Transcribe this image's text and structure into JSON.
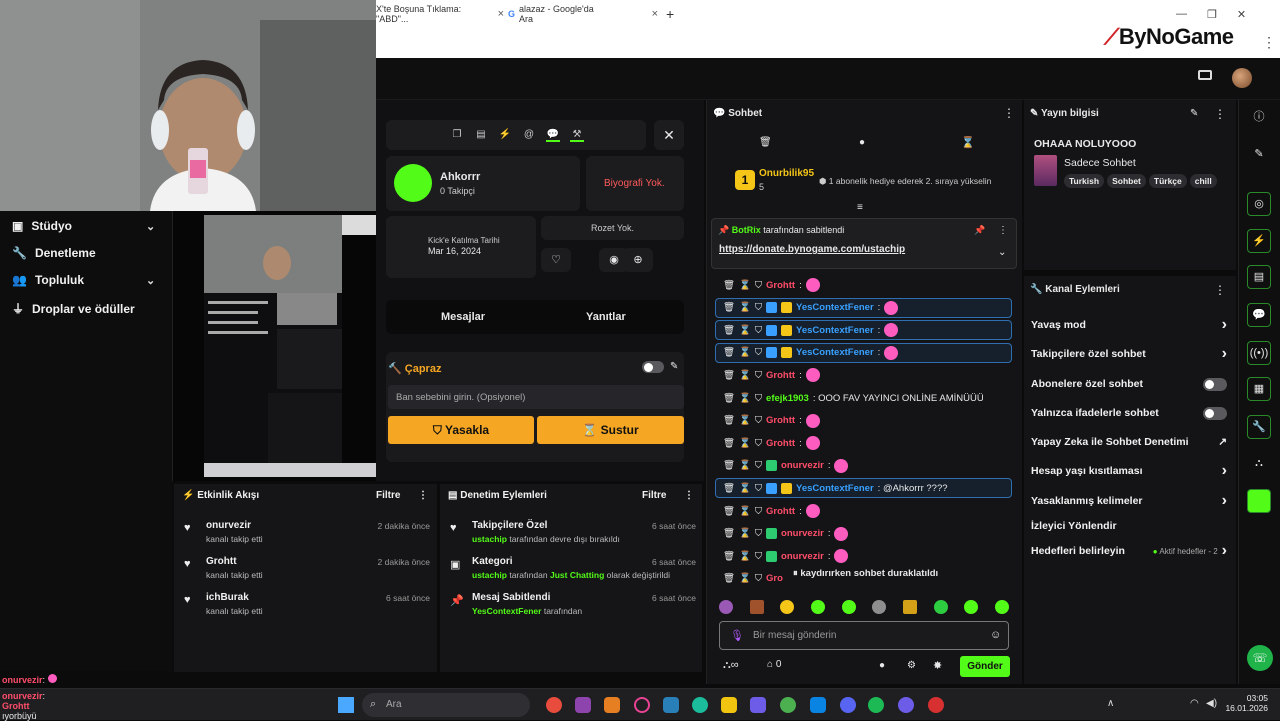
{
  "browser": {
    "tabs": [
      {
        "label": "X'te Boşuna Tıklama: \"ABD\"..."
      },
      {
        "label": "alazaz - Google'da Ara"
      }
    ],
    "new_tab": "+",
    "overlay_logo": "ByNoGame",
    "menu": "⋮"
  },
  "left_nav": {
    "items": [
      {
        "label": "Stüdyo"
      },
      {
        "label": "Denetleme"
      },
      {
        "label": "Topluluk"
      },
      {
        "label": "Droplar ve ödüller"
      }
    ]
  },
  "profile": {
    "name": "Ahkorrr",
    "followers": "0 Takipçi",
    "bio": "Biyografi Yok.",
    "join_label": "Kick'e Katılma Tarihi",
    "join_date": "Mar 16, 2024",
    "badges": "Rozet Yok.",
    "tab_messages": "Mesajlar",
    "tab_replies": "Yanıtlar",
    "ban_title": "Çapraz",
    "ban_placeholder": "Ban sebebini girin. (Opsiyonel)",
    "ban_button": "Yasakla",
    "mute_button": "Sustur"
  },
  "chat": {
    "title": "Sohbet",
    "gift_user": "Onurbilik95",
    "gift_count": "5",
    "gift_text": "1 abonelik hediye ederek 2. sıraya yükselin",
    "pinned_user": "BotRix",
    "pinned_suffix": "tarafından sabitlendi",
    "pinned_link": "https://donate.bynogame.com/ustachip",
    "messages": [
      {
        "user": "Grohtt",
        "text": ":",
        "style": "red",
        "emote": true
      },
      {
        "user": "YesContextFener",
        "text": ":",
        "style": "blue",
        "emote": true,
        "hl": true
      },
      {
        "user": "YesContextFener",
        "text": ":",
        "style": "blue",
        "emote": true,
        "hl": true
      },
      {
        "user": "YesContextFener",
        "text": ":",
        "style": "blue",
        "emote": true,
        "hl": true
      },
      {
        "user": "Grohtt",
        "text": ":",
        "style": "red",
        "emote": true
      },
      {
        "user": "efejk1903",
        "text": ": OOO FAV YAYINCI ONLİNE AMİNÜÜÜ",
        "style": "green",
        "emote": false
      },
      {
        "user": "Grohtt",
        "text": ":",
        "style": "red",
        "emote": true
      },
      {
        "user": "Grohtt",
        "text": ":",
        "style": "red",
        "emote": true
      },
      {
        "user": "onurvezir",
        "text": ":",
        "style": "red",
        "emote": true
      },
      {
        "user": "YesContextFener",
        "text": ": @Ahkorrr ????",
        "style": "blue",
        "emote": false,
        "hl": true
      },
      {
        "user": "Grohtt",
        "text": ":",
        "style": "red",
        "emote": true
      },
      {
        "user": "onurvezir",
        "text": ":",
        "style": "red",
        "emote": true
      },
      {
        "user": "onurvezir",
        "text": ":",
        "style": "red",
        "emote": true
      },
      {
        "user": "Gro",
        "text": "",
        "style": "red",
        "emote": false
      }
    ],
    "paused_text": "kaydırırken sohbet duraklatıldı",
    "input_placeholder": "Bir mesaj gönderin",
    "points": "0",
    "send_button": "Gönder"
  },
  "stream_info": {
    "title": "Yayın bilgisi",
    "stream_title": "OHAAA NOLUYOOO",
    "category": "Sadece Sohbet",
    "tags": [
      "Turkish",
      "Sohbet",
      "Türkçe",
      "chill"
    ]
  },
  "channel_actions": {
    "title": "Kanal Eylemleri",
    "items": [
      {
        "label": "Yavaş mod",
        "kind": "chevron"
      },
      {
        "label": "Takipçilere özel sohbet",
        "kind": "chevron"
      },
      {
        "label": "Abonelere özel sohbet",
        "kind": "toggle"
      },
      {
        "label": "Yalnızca ifadelerle sohbet",
        "kind": "toggle"
      },
      {
        "label": "Yapay Zeka ile Sohbet Denetimi",
        "kind": "external"
      },
      {
        "label": "Hesap yaşı kısıtlaması",
        "kind": "chevron"
      },
      {
        "label": "Yasaklanmış kelimeler",
        "kind": "chevron"
      },
      {
        "label": "İzleyici Yönlendir",
        "kind": "none"
      },
      {
        "label": "Hedefleri belirleyin",
        "kind": "chevron"
      }
    ],
    "goals_status": "Aktif hedefler - 2"
  },
  "activity_feed": {
    "title": "Etkinlik Akışı",
    "filter": "Filtre",
    "items": [
      {
        "user": "onurvezir",
        "text": "kanalı takip etti",
        "time": "2 dakika önce"
      },
      {
        "user": "Grohtt",
        "text": "kanalı takip etti",
        "time": "2 dakika önce"
      },
      {
        "user": "ichBurak",
        "text": "kanalı takip etti",
        "time": "6 saat önce"
      }
    ]
  },
  "moderation": {
    "title": "Denetim Eylemleri",
    "filter": "Filtre",
    "items": [
      {
        "title": "Takipçilere Özel",
        "actor": "ustachip",
        "text": "tarafından devre dışı bırakıldı",
        "time": "6 saat önce"
      },
      {
        "title": "Kategori",
        "actor": "ustachip",
        "text": "tarafından",
        "extra": "Just Chatting",
        "extra2": "olarak değiştirildi",
        "time": "6 saat önce"
      },
      {
        "title": "Mesaj Sabitlendi",
        "actor": "YesContextFener",
        "text": "tarafından",
        "time": "6 saat önce"
      }
    ]
  },
  "overlay_chat": [
    {
      "user": "onurvezir",
      "text": ":"
    },
    {
      "user": "onurvezir",
      "text": ":"
    },
    {
      "user": "Grohtt",
      "text": "ıyorbüyü"
    }
  ],
  "taskbar": {
    "search": "Ara",
    "time": "03:05",
    "date": "16.01.2026"
  },
  "colors": {
    "accent_green": "#53fc18",
    "ban_orange": "#f5a623",
    "blue_name": "#3aa0ff",
    "red_name": "#ff4d6a"
  }
}
